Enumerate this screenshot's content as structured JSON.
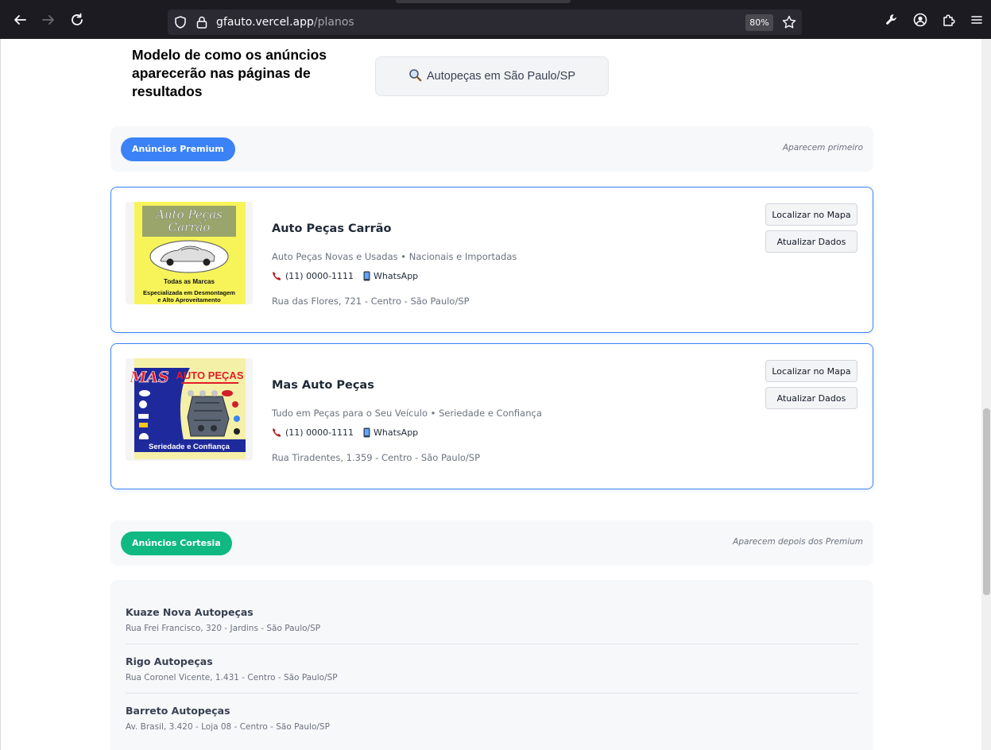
{
  "browser": {
    "url_domain": "gfauto.vercel.app",
    "url_path": "/planos",
    "zoom": "80%"
  },
  "header": {
    "title": "Modelo de como os anúncios aparecerão nas páginas de resultados",
    "search_example": "Autopeças em São Paulo/SP"
  },
  "premium": {
    "badge": "Anúncios Premium",
    "note": "Aparecem primeiro",
    "ads": [
      {
        "name": "Auto Peças Carrão",
        "description": "Auto Peças Novas e Usadas • Nacionais e Importadas",
        "phone": "(11) 0000-1111",
        "whatsapp": "WhatsApp",
        "address": "Rua das Flores, 721 - Centro - São Paulo/SP",
        "map_button": "Localizar no Mapa",
        "update_button": "Atualizar Dados",
        "logo": {
          "line1": "Auto Peças",
          "line2": "Carrão",
          "line3": "Todas as Marcas",
          "line4": "Especializada em Desmontagem",
          "line5": "e Alto Aproveitamento"
        }
      },
      {
        "name": "Mas Auto Peças",
        "description": "Tudo em Peças para o Seu Veículo • Seriedade e Confiança",
        "phone": "(11) 0000-1111",
        "whatsapp": "WhatsApp",
        "address": "Rua Tiradentes, 1.359 - Centro - São Paulo/SP",
        "map_button": "Localizar no Mapa",
        "update_button": "Atualizar Dados",
        "logo": {
          "mark": "MAS",
          "title": "AUTO PEÇAS",
          "footer": "Seriedade e Confiança"
        }
      }
    ]
  },
  "courtesy": {
    "badge": "Anúncios Cortesia",
    "note": "Aparecem depois dos Premium",
    "items": [
      {
        "name": "Kuaze Nova Autopeças",
        "address": "Rua Frei Francisco, 320 - Jardins - São Paulo/SP"
      },
      {
        "name": "Rigo Autopeças",
        "address": "Rua Coronel Vicente, 1.431 - Centro - São Paulo/SP"
      },
      {
        "name": "Barreto Autopeças",
        "address": "Av. Brasil, 3.420 - Loja 08 - Centro - São Paulo/SP"
      }
    ]
  },
  "colors": {
    "premium_accent": "#3b82f6",
    "courtesy_accent": "#10b981",
    "browser_chrome": "#1c1b22"
  }
}
